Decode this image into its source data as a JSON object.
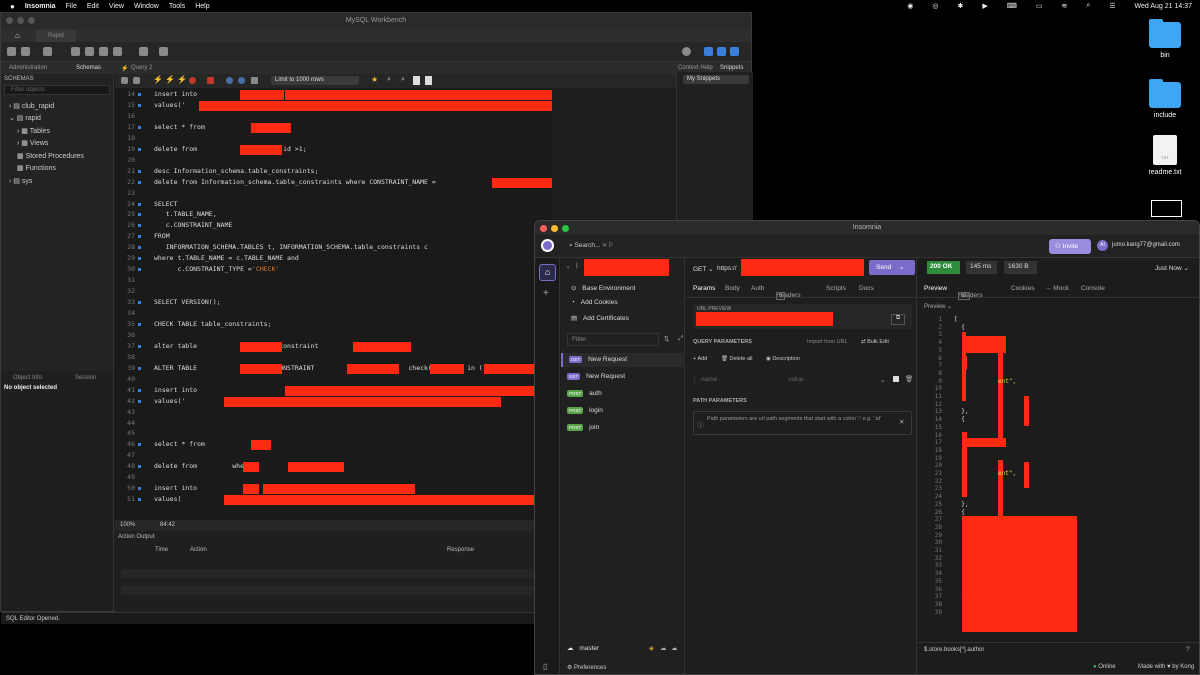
{
  "menubar": {
    "app": "Insomnia",
    "items": [
      "File",
      "Edit",
      "View",
      "Window",
      "Tools",
      "Help"
    ],
    "clock": "Wed Aug 21  14:37"
  },
  "workbench": {
    "title": "MySQL Workbench",
    "home_tab": "Rapid",
    "sub_tabs": [
      "Administration",
      "Schemas"
    ],
    "query_tab": "Query 2",
    "limit": "Limit to 1000 rows",
    "right_tabs": [
      "Context Help",
      "Snippets"
    ],
    "snippets": "My Snippets",
    "schemas_header": "SCHEMAS",
    "filter_placeholder": "Filter objects",
    "tree": [
      "club_rapid",
      "rapid",
      "Tables",
      "Views",
      "Stored Procedures",
      "Functions",
      "sys"
    ],
    "obj_tabs": [
      "Object Info",
      "Session"
    ],
    "no_object": "No object selected",
    "zoom": "100%",
    "cursor": "84:42",
    "output_label": "Action Output",
    "output_cols": [
      "Time",
      "Action",
      "Response"
    ],
    "status": "SQL Editor Opened.",
    "lines": [
      {
        "n": "14",
        "t": "insert into "
      },
      {
        "n": "15",
        "t": "values('"
      },
      {
        "n": "16",
        "t": ""
      },
      {
        "n": "17",
        "t": "select * from "
      },
      {
        "n": "18",
        "t": ""
      },
      {
        "n": "19",
        "t": "delete from                where id >1;"
      },
      {
        "n": "20",
        "t": ""
      },
      {
        "n": "21",
        "t": "desc Information_schema.table_constraints;"
      },
      {
        "n": "22",
        "t": "delete from Information_schema.table_constraints where CONSTRAINT_NAME = "
      },
      {
        "n": "23",
        "t": ""
      },
      {
        "n": "24",
        "t": "SELECT"
      },
      {
        "n": "25",
        "t": "   t.TABLE_NAME,"
      },
      {
        "n": "26",
        "t": "   c.CONSTRAINT_NAME"
      },
      {
        "n": "27",
        "t": "FROM"
      },
      {
        "n": "28",
        "t": "   INFORMATION_SCHEMA.TABLES t, INFORMATION_SCHEMA.table_constraints c"
      },
      {
        "n": "29",
        "t": "where t.TABLE_NAME = c.TABLE_NAME and"
      },
      {
        "n": "30",
        "t": "      c.CONSTRAINT_TYPE = "
      },
      {
        "n": "31",
        "t": ""
      },
      {
        "n": "32",
        "t": ""
      },
      {
        "n": "33",
        "t": "SELECT VERSION();"
      },
      {
        "n": "34",
        "t": ""
      },
      {
        "n": "35",
        "t": "CHECK TABLE table_constraints;"
      },
      {
        "n": "36",
        "t": ""
      },
      {
        "n": "37",
        "t": "alter table                drop constraint"
      },
      {
        "n": "38",
        "t": ""
      },
      {
        "n": "39",
        "t": "ALTER TABLE                ADD CONSTRAINT                        check(         in ("
      },
      {
        "n": "40",
        "t": ""
      },
      {
        "n": "41",
        "t": "insert into"
      },
      {
        "n": "42",
        "t": "values('"
      },
      {
        "n": "43",
        "t": ""
      },
      {
        "n": "44",
        "t": ""
      },
      {
        "n": "45",
        "t": ""
      },
      {
        "n": "46",
        "t": "select * from"
      },
      {
        "n": "47",
        "t": ""
      },
      {
        "n": "48",
        "t": "delete from         where"
      },
      {
        "n": "49",
        "t": ""
      },
      {
        "n": "50",
        "t": "insert into"
      },
      {
        "n": "51",
        "t": "values("
      }
    ],
    "check_str": "'CHECK'"
  },
  "desktop": {
    "icons": [
      "bin",
      "include",
      "readme.txt"
    ],
    "txt_badge": "TXT"
  },
  "insomnia": {
    "title": "Insomnia",
    "search": "Search...",
    "search_hint": "⌘ P",
    "invite": "Invite",
    "user": "jumo.kang77@gmail.com",
    "env_items": [
      "Base Environment",
      "Add Cookies",
      "Add Certificates"
    ],
    "filter_placeholder": "Filter",
    "requests": [
      {
        "m": "GET",
        "n": "New Request"
      },
      {
        "m": "GET",
        "n": "New Request"
      },
      {
        "m": "POST",
        "n": "auth"
      },
      {
        "m": "POST",
        "n": "login"
      },
      {
        "m": "POST",
        "n": "join"
      }
    ],
    "branch": "master",
    "method": "GET",
    "url_prefix": "https://",
    "send": "Send",
    "status_code": "200 OK",
    "time": "145 ms",
    "size": "1630 B",
    "just_now": "Just Now",
    "req_tabs": [
      "Params",
      "Body",
      "Auth",
      "Headers",
      "Scripts",
      "Docs"
    ],
    "headers_count": "3",
    "url_preview": "URL PREVIEW",
    "query_params": "QUERY PARAMETERS",
    "import_url": "Import from URL",
    "bulk_edit": "Bulk Edit",
    "add": "Add",
    "delete_all": "Delete all",
    "description": "Description",
    "name_ph": "name",
    "value_ph": "value",
    "path_params": "PATH PARAMETERS",
    "path_hint": "Path parameters are url path segments that start with a colon ':' e.g. ':id'",
    "resp_tabs": [
      "Preview",
      "Headers",
      "Cookies",
      "→ Mock",
      "Console"
    ],
    "resp_headers_count": "13",
    "preview_label": "Preview",
    "filter_expr": "$.store.books[*].author",
    "preferences": "Preferences",
    "online": "Online",
    "made_with": "Made with ♥ by Kong",
    "json_lines": [
      "[",
      "  {",
      "",
      "",
      "",
      "",
      "",
      "",
      "",
      "",
      "",
      "",
      "  },",
      "  {",
      "",
      "",
      "",
      "",
      "",
      "",
      "",
      "",
      "",
      "",
      "  },",
      "  {",
      "",
      "",
      "",
      "",
      "",
      "",
      "",
      "",
      "",
      "",
      "  },",
      "  {",
      ""
    ],
    "json_ent1": "ent\",",
    "json_ent2": "ent\","
  },
  "colors": {
    "accent": "#7a6cc9",
    "redact": "#ff2a12",
    "ok": "#2e8b3a"
  }
}
